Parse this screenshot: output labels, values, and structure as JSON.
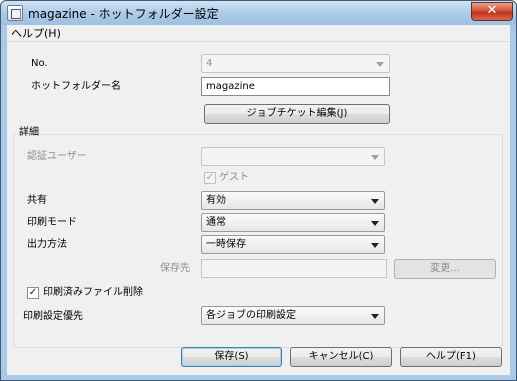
{
  "window": {
    "title": "magazine - ホットフォルダー設定"
  },
  "menu": {
    "help": "ヘルプ(H)"
  },
  "close_glyph": "✕",
  "fields": {
    "no_label": "No.",
    "no_value": "4",
    "name_label": "ホットフォルダー名",
    "name_value": "magazine",
    "job_ticket_button": "ジョブチケット編集(J)"
  },
  "details": {
    "group_title": "詳細",
    "auth_user_label": "認証ユーザー",
    "auth_user_value": "",
    "guest_label": "ゲスト",
    "guest_checked": true,
    "share_label": "共有",
    "share_value": "有効",
    "print_mode_label": "印刷モード",
    "print_mode_value": "通常",
    "output_label": "出力方法",
    "output_value": "一時保存",
    "save_to_label": "保存先",
    "save_to_value": "",
    "change_button": "変更...",
    "delete_after_print_label": "印刷済みファイル削除",
    "delete_after_print_checked": true
  },
  "priority": {
    "label": "印刷設定優先",
    "value": "各ジョブの印刷設定"
  },
  "buttons": {
    "save": "保存(S)",
    "cancel": "キャンセル(C)",
    "help": "ヘルプ(F1)"
  },
  "check_glyph": "✓"
}
